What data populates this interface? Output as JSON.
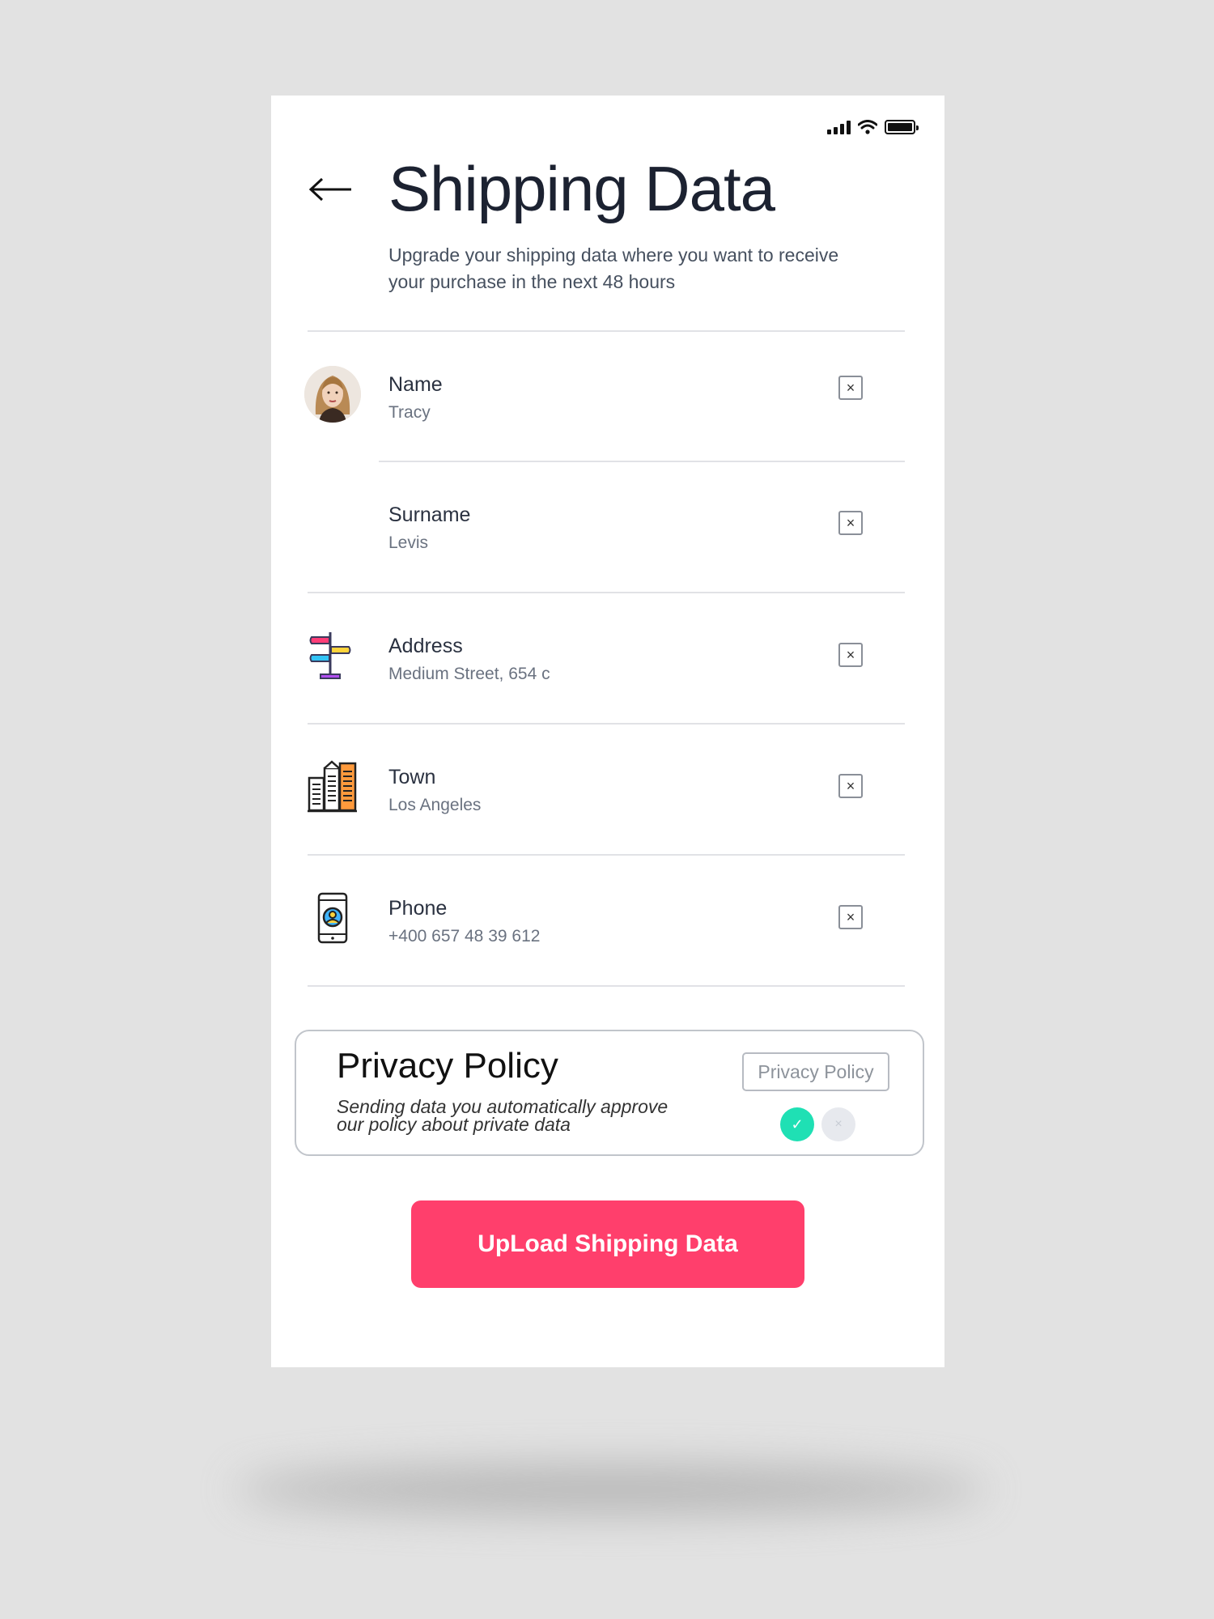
{
  "header": {
    "title": "Shipping Data",
    "subtitle": "Upgrade your shipping data where you want to receive your purchase in the next 48 hours",
    "back_icon": "arrow-left-icon"
  },
  "status_bar": {
    "icons": [
      "signal-icon",
      "wifi-icon",
      "battery-icon"
    ]
  },
  "fields": [
    {
      "label": "Name",
      "value": "Tracy",
      "icon": "avatar",
      "clear_icon": "close-icon",
      "clear_symbol": "×"
    },
    {
      "label": "Surname",
      "value": "Levis",
      "icon": "none",
      "clear_icon": "close-icon",
      "clear_symbol": "×"
    },
    {
      "label": "Address",
      "value": "Medium Street, 654 c",
      "icon": "signpost-icon",
      "clear_icon": "close-icon",
      "clear_symbol": "×"
    },
    {
      "label": "Town",
      "value": "Los Angeles",
      "icon": "city-buildings-icon",
      "clear_icon": "close-icon",
      "clear_symbol": "×"
    },
    {
      "label": "Phone",
      "value": "+400 657 48 39 612",
      "icon": "smartphone-contact-icon",
      "clear_icon": "close-icon",
      "clear_symbol": "×"
    }
  ],
  "privacy": {
    "title": "Privacy Policy",
    "text": "Sending data you automatically approve our policy about private data",
    "button_label": "Privacy Policy",
    "accept_symbol": "✓",
    "decline_symbol": "×",
    "accepted": true,
    "accept_color": "#1fe0b4",
    "decline_color": "#e7e9ee"
  },
  "upload_button": {
    "label": "UpLoad Shipping Data",
    "color": "#ff3f6c"
  }
}
